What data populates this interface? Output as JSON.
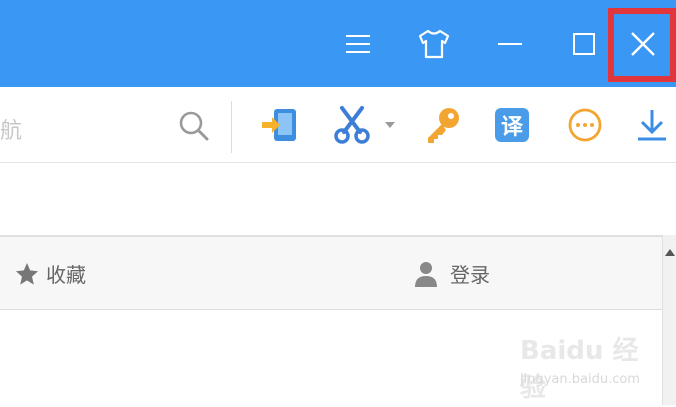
{
  "titlebar": {
    "color": "#3b97f4",
    "buttons": {
      "menu_icon": "hamburger-menu-icon",
      "skin_icon": "tshirt-skin-icon",
      "minimize_icon": "minimize-icon",
      "maximize_icon": "maximize-icon",
      "close_icon": "close-icon"
    },
    "highlight_color": "#e1363c"
  },
  "toolbar": {
    "address_text": "航",
    "tools": [
      "phone-transfer-icon",
      "scissors-icon",
      "dropdown-arrow-icon",
      "key-icon",
      "translate-icon",
      "more-icon",
      "download-icon"
    ],
    "translate_label": "译"
  },
  "panel": {
    "favorites_label": "收藏",
    "login_label": "登录"
  },
  "watermark": {
    "main": "Baidu 经验",
    "sub": "jingyan.baidu.com"
  }
}
